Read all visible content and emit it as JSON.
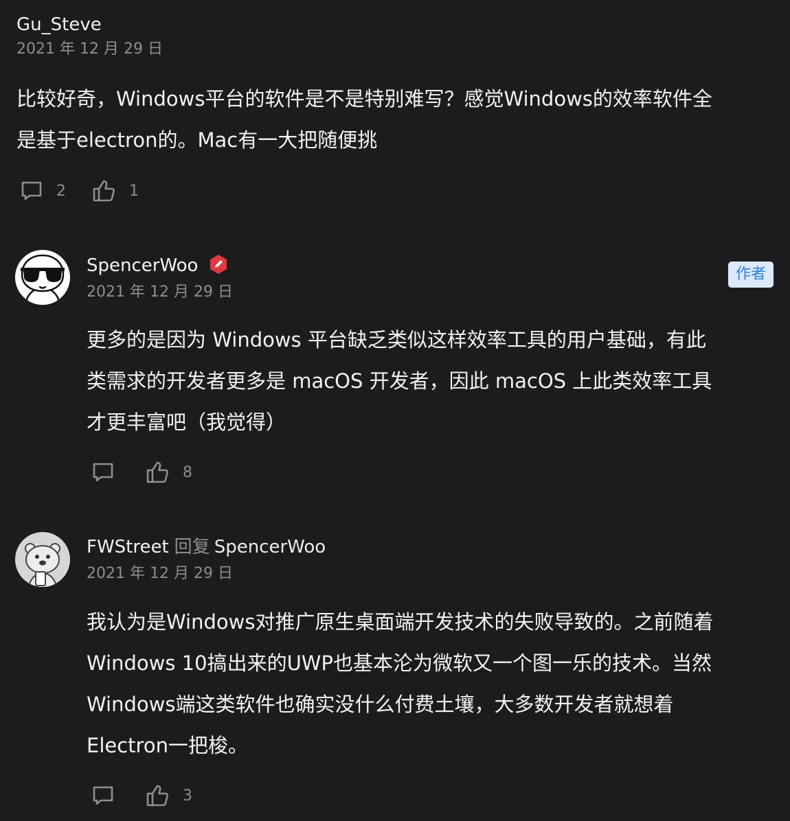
{
  "comments": [
    {
      "username": "Gu_Steve",
      "date": "2021 年 12 月 29 日",
      "lines": [
        "比较好奇，Windows平台的软件是不是特别难写？感觉Windows的效率软件全",
        "是基于electron的。Mac有一大把随便挑"
      ],
      "reply_count": "2",
      "like_count": "1"
    },
    {
      "username": "SpencerWoo",
      "badge": "作者",
      "verified_icon": "pencil-icon",
      "avatar_icon": "sunglasses-avatar-icon",
      "date": "2021 年 12 月 29 日",
      "lines": [
        "更多的是因为 Windows 平台缺乏类似这样效率工具的用户基础，有此",
        "类需求的开发者更多是 macOS 开发者，因此 macOS 上此类效率工具",
        "才更丰富吧（我觉得）"
      ],
      "like_count": "8"
    },
    {
      "username": "FWStreet",
      "reply_word": "回复",
      "reply_target": "SpencerWoo",
      "avatar_icon": "otter-avatar-icon",
      "date": "2021 年 12 月 29 日",
      "lines": [
        "我认为是Windows对推广原生桌面端开发技术的失败导致的。之前随着",
        "Windows 10搞出来的UWP也基本沦为微软又一个图一乐的技术。当然",
        "Windows端这类软件也确实没什么付费土壤，大多数开发者就想着",
        "Electron一把梭。"
      ],
      "like_count": "3"
    }
  ],
  "colors": {
    "background": "#1c1c1e",
    "text": "#f2f2f7",
    "muted": "#8e8e93",
    "badge_bg": "#dce9fb",
    "badge_text": "#2f7fe0",
    "verified": "#e0393e"
  }
}
